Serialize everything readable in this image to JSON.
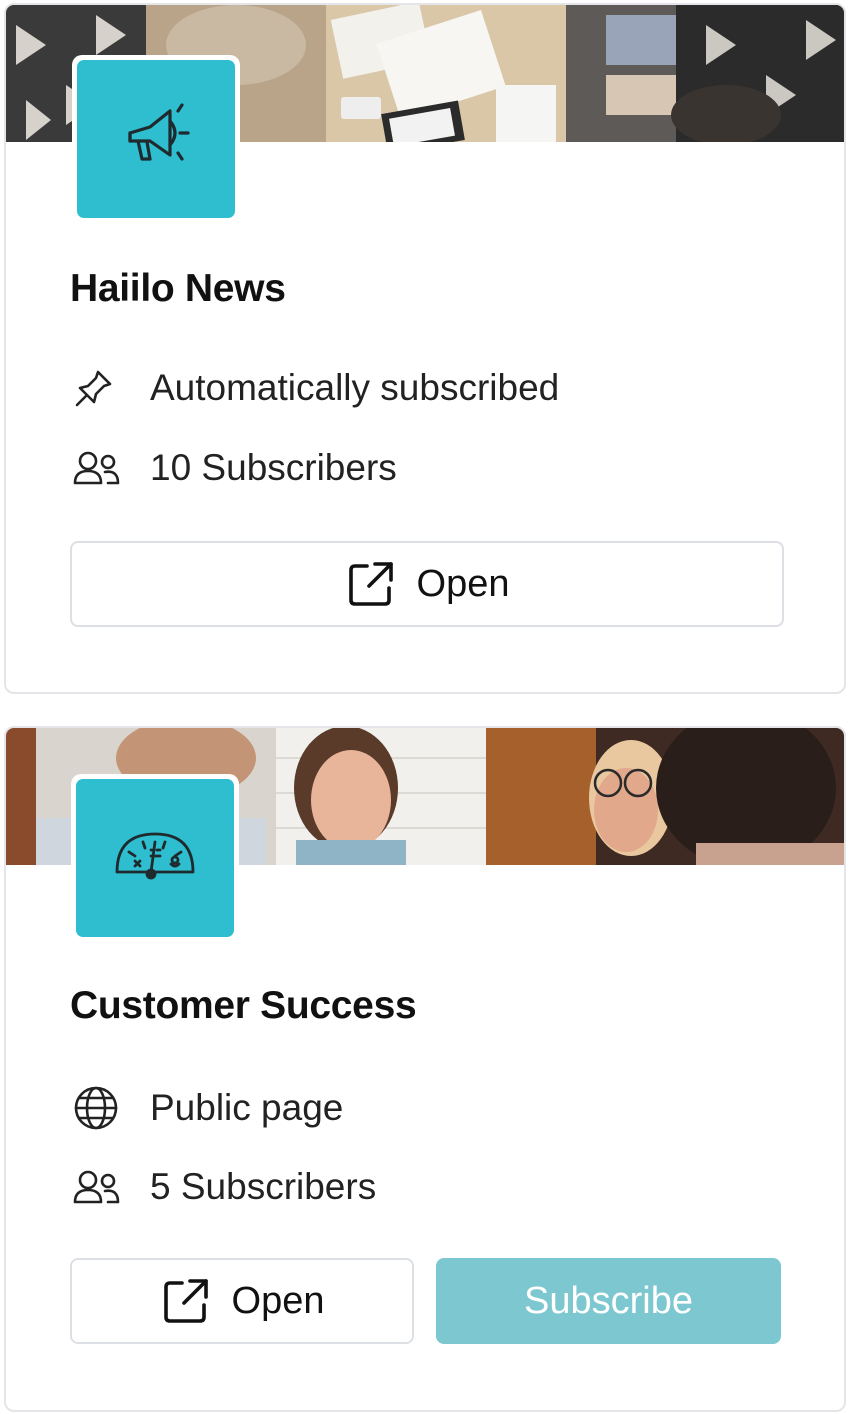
{
  "cards": [
    {
      "title": "Haiilo News",
      "logo_icon": "megaphone-icon",
      "meta": [
        {
          "icon": "pin-icon",
          "text": "Automatically subscribed"
        },
        {
          "icon": "users-icon",
          "text": "10 Subscribers"
        }
      ],
      "open_label": "Open"
    },
    {
      "title": "Customer Success",
      "logo_icon": "gauge-icon",
      "meta": [
        {
          "icon": "globe-icon",
          "text": "Public page"
        },
        {
          "icon": "users-icon",
          "text": "5 Subscribers"
        }
      ],
      "open_label": "Open",
      "subscribe_label": "Subscribe"
    }
  ],
  "colors": {
    "logo_bg": "#2ebecf",
    "subscribe_bg": "#7cc7d0",
    "border": "#e3e5e8"
  }
}
